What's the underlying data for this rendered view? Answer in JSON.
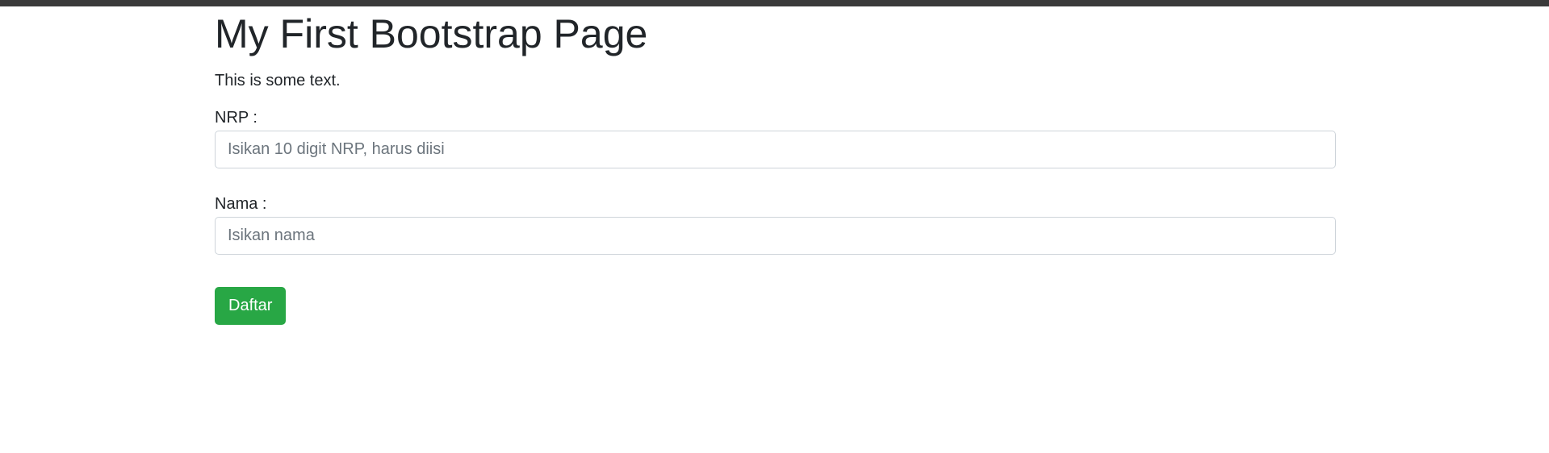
{
  "page": {
    "title": "My First Bootstrap Page",
    "intro_text": "This is some text."
  },
  "form": {
    "nrp": {
      "label": "NRP :",
      "placeholder": "Isikan 10 digit NRP, harus diisi",
      "value": ""
    },
    "nama": {
      "label": "Nama :",
      "placeholder": "Isikan nama",
      "value": ""
    },
    "submit_label": "Daftar"
  },
  "colors": {
    "top_bar": "#3a3a3a",
    "button_success": "#28a745",
    "text": "#212529",
    "placeholder": "#6c757d",
    "input_border": "#ced4da"
  }
}
